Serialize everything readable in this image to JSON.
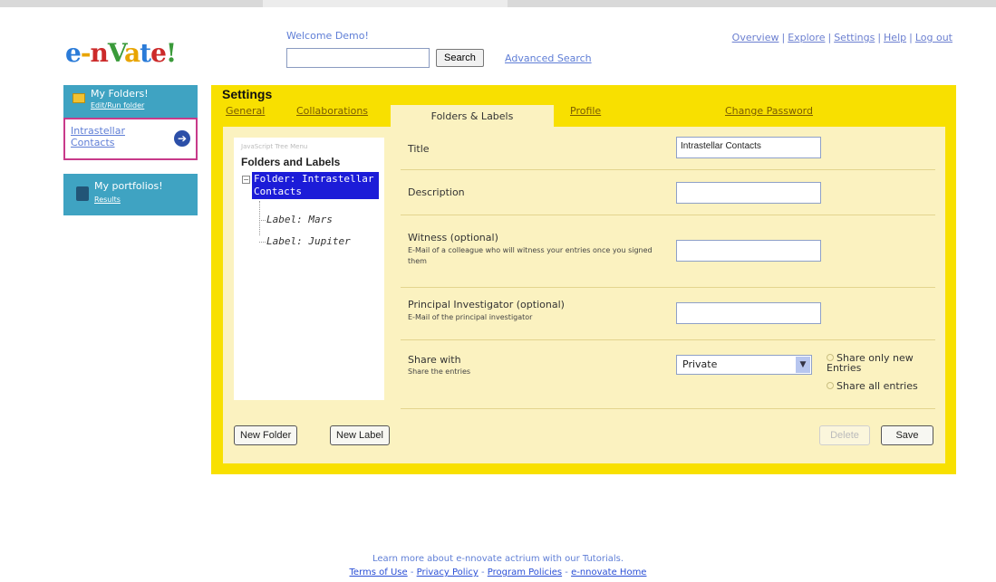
{
  "header": {
    "logo_text": "e-novate!",
    "welcome": "Welcome Demo!",
    "search": {
      "value": "",
      "button": "Search",
      "advanced": "Advanced Search"
    },
    "nav": [
      "Overview",
      "Explore",
      "Settings",
      "Help",
      "Log out"
    ]
  },
  "sidebar": {
    "folders": {
      "title": "My Folders!",
      "link": "Edit/Run folder"
    },
    "current": {
      "label": "Intrastellar Contacts"
    },
    "portfolios": {
      "title": "My portfolios!",
      "link": "Results"
    }
  },
  "settings": {
    "title": "Settings",
    "tabs": [
      "General",
      "Collaborations",
      "Folders & Labels",
      "Profile",
      "Change Password"
    ],
    "active_tab": "Folders & Labels",
    "tree": {
      "hint": "JavaScript Tree Menu",
      "heading": "Folders and Labels",
      "folder": "Folder: Intrastellar Contacts",
      "labels": [
        "Label: Mars",
        "Label: Jupiter"
      ]
    },
    "form": {
      "title": {
        "label": "Title",
        "value": "Intrastellar Contacts"
      },
      "description": {
        "label": "Description",
        "value": ""
      },
      "witness": {
        "label": "Witness (optional)",
        "hint": "E-Mail of a colleague who will witness your entries once you signed them",
        "value": ""
      },
      "pi": {
        "label": "Principal Investigator (optional)",
        "hint": "E-Mail of the principal investigator",
        "value": ""
      },
      "share": {
        "label": "Share with",
        "hint": "Share the entries",
        "selected": "Private",
        "options": [
          "Share only new Entries",
          "Share all entries"
        ]
      }
    },
    "buttons": {
      "new_folder": "New Folder",
      "new_label": "New Label",
      "delete": "Delete",
      "save": "Save"
    }
  },
  "footer": {
    "line1": "Learn more about e-nnovate actrium with our Tutorials.",
    "links": [
      "Terms of Use",
      "Privacy Policy",
      "Program Policies",
      "e-nnovate Home"
    ]
  }
}
